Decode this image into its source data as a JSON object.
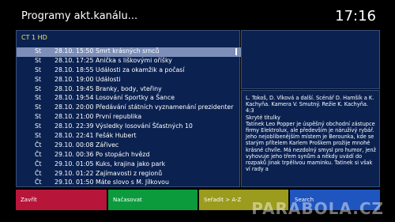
{
  "header": {
    "title": "Programy akt.kanálu...",
    "clock": "17:16"
  },
  "channel": {
    "name": "CT 1 HD"
  },
  "programmes": [
    {
      "day": "St",
      "date": "28.10.",
      "time": "15:50",
      "name": "Smrt krásných srnců",
      "selected": true
    },
    {
      "day": "St",
      "date": "28.10.",
      "time": "17:25",
      "name": "Anička s liškovými oříšky"
    },
    {
      "day": "St",
      "date": "28.10.",
      "time": "18:55",
      "name": "Události za okamžik a počasí"
    },
    {
      "day": "St",
      "date": "28.10.",
      "time": "19:00",
      "name": "Události"
    },
    {
      "day": "St",
      "date": "28.10.",
      "time": "19:45",
      "name": "Branky, body, vteřiny"
    },
    {
      "day": "St",
      "date": "28.10.",
      "time": "19:54",
      "name": "Losování Sportky a Šance"
    },
    {
      "day": "St",
      "date": "28.10.",
      "time": "20:00",
      "name": "Předávání státních vyznamenání prezidenter"
    },
    {
      "day": "St",
      "date": "28.10.",
      "time": "21:00",
      "name": "První republika"
    },
    {
      "day": "St",
      "date": "28.10.",
      "time": "22:39",
      "name": "Výsledky losování Šťastných 10"
    },
    {
      "day": "St",
      "date": "28.10.",
      "time": "22:41",
      "name": "Fešák Hubert"
    },
    {
      "day": "Čt",
      "date": "29.10.",
      "time": "00:08",
      "name": "Zářivec"
    },
    {
      "day": "Čt",
      "date": "29.10.",
      "time": "00:36",
      "name": "Po stopách hvězd"
    },
    {
      "day": "Čt",
      "date": "29.10.",
      "time": "01:05",
      "name": "Kuks, krajina jako park"
    },
    {
      "day": "Čt",
      "date": "29.10.",
      "time": "01:22",
      "name": "Zajímavosti z regionů"
    },
    {
      "day": "Čt",
      "date": "29.10.",
      "time": "01:50",
      "name": "Máte slovo s M. Jílkovou"
    }
  ],
  "info": {
    "lines": [
      "L. Tokoš, D. Vlková a další. Scénář D. Hamšík a K. Kachyňa. Kamera V. Smutný. Režie K. Kachyňa.",
      "4:3",
      "Skryté titulky",
      "Tatinek Leo Popper je úspěšný obchodní zástupce firmy Elektrolux, ale především je náružívý rybář. Jeho nejoblíbenějším místem je Berounka, kde se starým přítelem Karlem Proškem prožije mnohé krásné chvíle. Má nezdolný smysl pro humor, jenž vyhovuje jeho třem synům a někdy uvádí do rozpaků jinak trpělivou maminku. Tatinek si však ví rady a"
    ]
  },
  "buttons": {
    "red": "Zavřít",
    "green": "Načasovat",
    "yellow": "Seřadit > A-Z",
    "blue": "Search"
  },
  "watermark": "PARABOLA.CZ"
}
